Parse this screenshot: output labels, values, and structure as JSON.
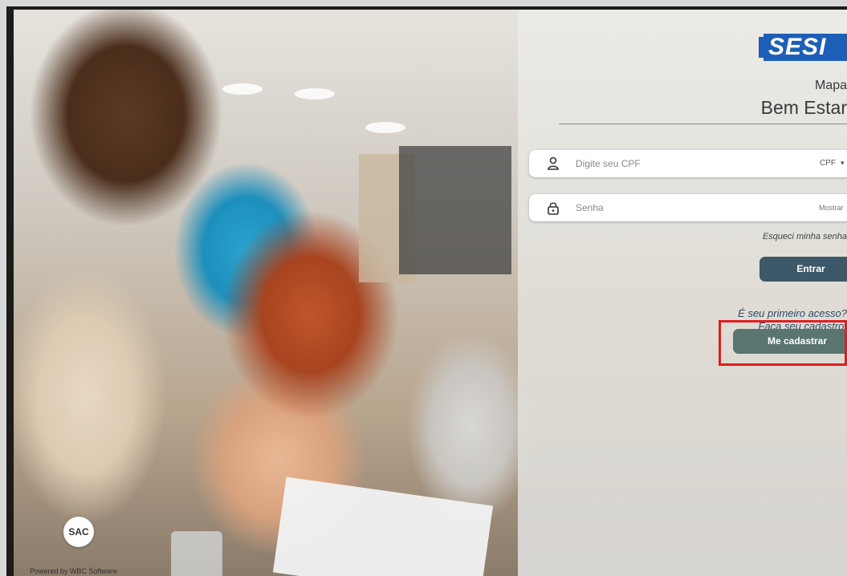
{
  "brand": {
    "logo_text": "SESI",
    "logo_color": "#1d5fb8"
  },
  "header": {
    "subtitle_top": "Mapa",
    "subtitle_bottom": "Bem Estar"
  },
  "login": {
    "cpf_placeholder": "Digite seu CPF",
    "cpf_type": "CPF",
    "cpf_caret": "▾",
    "password_placeholder": "Senha",
    "show_password_label": "Mostrar",
    "forgot_label": "Esqueci minha senha",
    "submit_label": "Entrar"
  },
  "signup": {
    "prompt_line1": "É seu primeiro acesso?",
    "prompt_line2": "Faça seu cadastro!",
    "button_label": "Me cadastrar",
    "highlight_color": "#e01e1e"
  },
  "footer": {
    "sac_label": "SAC",
    "powered_by": "Powered by WBC Software"
  },
  "icons": {
    "user": "user-icon",
    "lock": "lock-icon"
  }
}
